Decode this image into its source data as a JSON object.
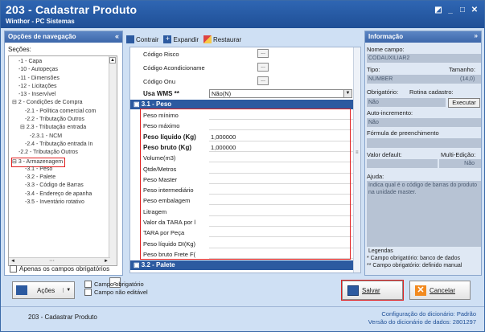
{
  "window": {
    "title": "203 - Cadastrar  Produto",
    "subtitle": "Winthor - PC Sistemas",
    "controls": [
      "◩",
      "_",
      "□",
      "✕"
    ]
  },
  "nav": {
    "header": "Opções de navegação",
    "collapse": "«",
    "sections_label": "Seções:",
    "items": [
      "1 - Capa",
      "10 - Autopeças",
      "11 - Dimensões",
      "12 - Licitações",
      "13 - Inservível",
      "2 - Condições de Compra",
      "2.1 - Política comercial com",
      "2.2 - Tributação Outros",
      "2.3 - Tributação entrada",
      "2.3.1 - NCM",
      "2.4 - Tributação entrada In",
      "2.2 - Tributação Outros",
      "3 - Armazenagem",
      "3.1 - Peso",
      "3.2 - Palete",
      "3.3 - Código de Barras",
      "3.4 - Endereço de apanha",
      "3.5 - Inventário rotativo"
    ],
    "hscroll_label": "···",
    "only_required_label": "Apenas os campos obrigatórios"
  },
  "toolbar": {
    "collapse_label": "Contrair",
    "expand_label": "Expandir",
    "restore_label": "Restaurar"
  },
  "form": {
    "rows_top": [
      {
        "label": "Código Risco",
        "value": ""
      },
      {
        "label": "Código Acondicioname",
        "value": ""
      },
      {
        "label": "Código Onu",
        "value": ""
      }
    ],
    "usa_wms": {
      "label": "Usa WMS **",
      "value": "Não(N)"
    },
    "section_peso": "3.1 - Peso",
    "peso_rows": [
      {
        "label": "Peso mínimo",
        "value": "",
        "bold": false
      },
      {
        "label": "Peso máximo",
        "value": "",
        "bold": false
      },
      {
        "label": "Peso líquido (Kg)",
        "value": "1,000000",
        "bold": true
      },
      {
        "label": "Peso bruto (Kg)",
        "value": "1,000000",
        "bold": true
      },
      {
        "label": "Volume(m3)",
        "value": "",
        "bold": false
      },
      {
        "label": "Qtde/Metros",
        "value": "",
        "bold": false
      },
      {
        "label": "Peso Master",
        "value": "",
        "bold": false
      },
      {
        "label": "Peso intermediário",
        "value": "",
        "bold": false
      },
      {
        "label": "Peso embalagem",
        "value": "",
        "bold": false
      },
      {
        "label": "Litragem",
        "value": "",
        "bold": false
      },
      {
        "label": "Valor da TARA por l",
        "value": "",
        "bold": false
      },
      {
        "label": "TARA por Peça",
        "value": "",
        "bold": false
      },
      {
        "label": "Peso líquido DI(Kg)",
        "value": "",
        "bold": false
      },
      {
        "label": "Peso bruto Frete F(",
        "value": "",
        "bold": false
      }
    ],
    "section_palete": "3.2 - Palete",
    "dots": "...",
    "expand_mark": "▣"
  },
  "info": {
    "header": "Informação",
    "header_chev": "»",
    "field_name_label": "Nome campo:",
    "field_name": "CODAUXILIAR2",
    "type_label": "Tipo:",
    "size_label": "Tamanho:",
    "type_value": "NUMBER",
    "size_value": "(14,0)",
    "required_label": "Obrigatório:",
    "routine_label": "Rotina cadastro:",
    "required_value": "Não",
    "exec_button": "Executar",
    "autoinc_label": "Auto-incremento:",
    "autoinc_value": "Não",
    "formula_label": "Fórmula de preenchimento",
    "default_label": "Valor default:",
    "multi_label": "Multi-Edição:",
    "multi_value": "Não",
    "help_label": "Ajuda:",
    "help_text": "Indica qual é o código de barras do produto na unidade master.",
    "legend_title": "Legendas",
    "legend_1": "* Campo obrigatório: banco de dados",
    "legend_2": "** Campo obrigatório: definido manual"
  },
  "bottom": {
    "actions_label": "Ações",
    "required_field_label": "Campo obrigatório",
    "not_editable_label": "Campo não editável",
    "save_label": "Salvar",
    "cancel_label": "Cancelar"
  },
  "status": {
    "left": "203 - Cadastrar  Produto",
    "dict_config_label": "Configuração do dicionário: ",
    "dict_config_value": "Padrão",
    "dict_version_label": "Versão do dicionário de dados: ",
    "dict_version_value": "2801297"
  },
  "colors": {
    "title_bar": "#1f4f96",
    "section_header": "#2c5aa0",
    "highlight": "#e02020"
  }
}
